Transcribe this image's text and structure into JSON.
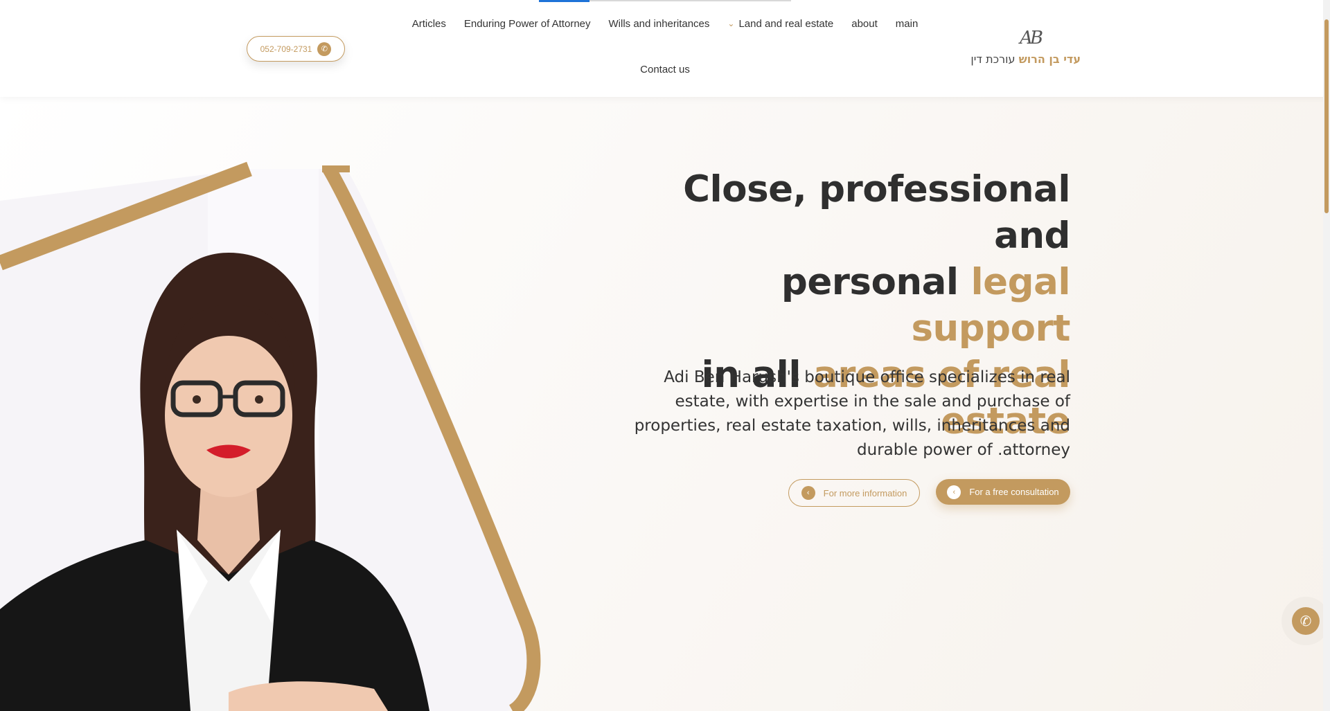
{
  "header": {
    "phone": "052-709-2731",
    "nav": {
      "items": [
        {
          "label": "Articles"
        },
        {
          "label": "Enduring Power of Attorney"
        },
        {
          "label": "Wills and inheritances"
        },
        {
          "label": "Land and real estate",
          "has_dropdown": true
        },
        {
          "label": "about"
        },
        {
          "label": "main"
        }
      ],
      "second_row": "Contact us"
    },
    "logo": {
      "monogram": "AB",
      "name_gold": "עדי בן הרוש",
      "name_dark": "עורכת דין"
    }
  },
  "hero": {
    "headline": {
      "line1": "Close, professional and",
      "line2_dark": "personal ",
      "line2_gold": "legal support",
      "line3_dark": "in all ",
      "line3_gold": "areas of real",
      "line4_gold": "estate"
    },
    "description": "Adi Ben Harush's boutique office specializes in real estate, with expertise in the sale and purchase of properties, real estate taxation, wills, inheritances and durable power of .attorney",
    "buttons": {
      "more_info": "For more information",
      "free_consult": "For a free consultation"
    }
  },
  "icons": {
    "phone": "phone-icon",
    "chevron": "chevron-down-icon",
    "arrow": "chevron-left-icon"
  },
  "colors": {
    "accent": "#c39a5f",
    "text": "#2f2f2f",
    "nav_active": "#1e73d8"
  }
}
